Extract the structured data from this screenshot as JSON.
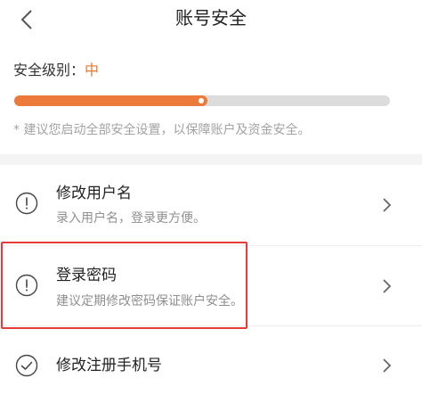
{
  "nav": {
    "title": "账号安全",
    "back_icon": "chevron-left-icon"
  },
  "security": {
    "label": "安全级别：",
    "level": "中",
    "progress_fraction": 0.5,
    "hint": "* 建议您启动全部安全设置，以保障账户及资金安全。"
  },
  "items": [
    {
      "title": "修改用户名",
      "desc": "录入用户名，登录更方便。",
      "icon": "exclamation-circle-icon",
      "status": "warning"
    },
    {
      "title": "登录密码",
      "desc": "建议定期修改密码保证账户安全。",
      "icon": "exclamation-circle-icon",
      "status": "warning"
    },
    {
      "title": "修改注册手机号",
      "desc": "",
      "icon": "check-circle-icon",
      "status": "ok"
    }
  ],
  "colors": {
    "accent": "#ec7a3a",
    "level_text": "#e8782e",
    "highlight": "#e23c3c"
  }
}
